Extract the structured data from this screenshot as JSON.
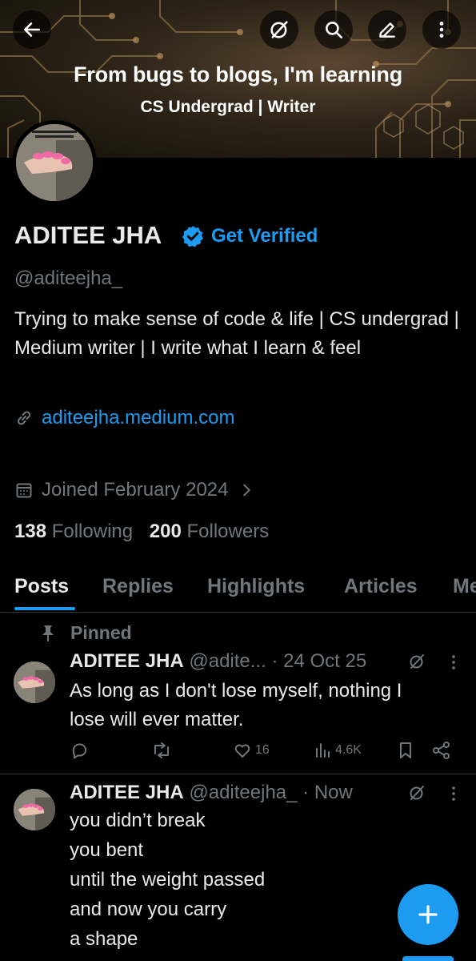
{
  "banner": {
    "title": "From bugs to blogs, I'm learning",
    "subtitle": "CS Undergrad | Writer"
  },
  "topbar": {
    "back_icon": "back-arrow-icon",
    "grok_icon": "slash-circle-icon",
    "search_icon": "search-icon",
    "edit_icon": "pencil-icon",
    "more_icon": "more-vertical-icon"
  },
  "profile": {
    "name": "ADITEE JHA",
    "get_verified": "Get Verified",
    "handle": "@aditeejha_",
    "bio": "Trying to make sense of code & life | CS undergrad | Medium writer | I write what I learn & feel",
    "link": "aditeejha.medium.com",
    "joined": "Joined February 2024",
    "following_count": "138",
    "following_label": "Following",
    "followers_count": "200",
    "followers_label": "Followers"
  },
  "tabs": [
    "Posts",
    "Replies",
    "Highlights",
    "Articles",
    "Me"
  ],
  "posts": [
    {
      "pinned_label": "Pinned",
      "name": "ADITEE JHA",
      "meta": "@adite... · 24 Oct 25",
      "lines": [
        "As long as I don't lose myself, nothing I",
        "lose will ever matter."
      ],
      "likes": "16",
      "views": "4.6K"
    },
    {
      "name": "ADITEE JHA",
      "meta": "@aditeejha_ · Now",
      "lines": [
        "you didn’t break",
        "you bent",
        "until the weight passed",
        "and now you carry",
        "a shape"
      ]
    }
  ],
  "colors": {
    "accent": "#1d9bf0",
    "muted": "#71767b",
    "text": "#e7e9ea",
    "background": "#000000"
  }
}
